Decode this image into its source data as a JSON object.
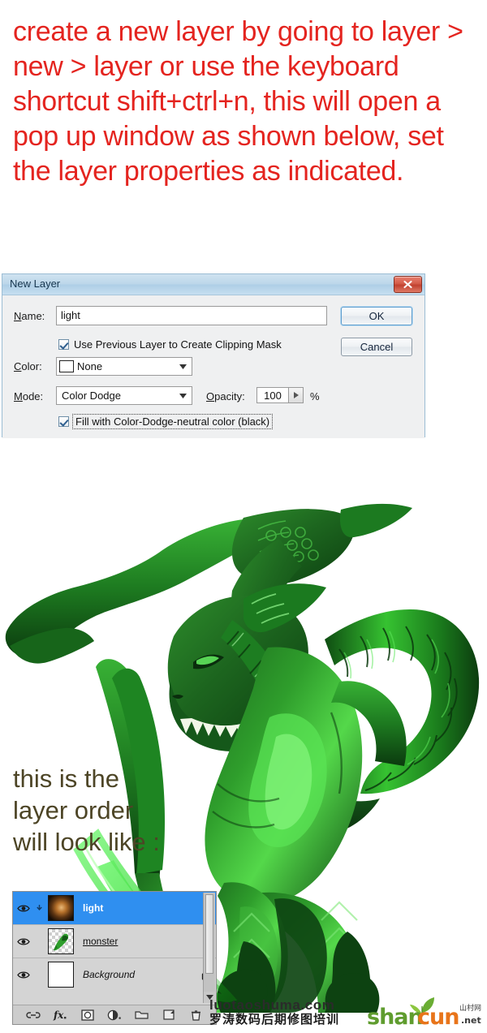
{
  "instruction": {
    "text": "create a new layer by going to layer > new > layer or use the keyboard shortcut shift+ctrl+n, this will open a pop up window as shown below, set the layer properties as indicated.",
    "color": "#e4241f"
  },
  "dialog": {
    "title": "New Layer",
    "close_icon": "close-icon",
    "name_label": "Name:",
    "name_label_mnemonic": "N",
    "name_value": "light",
    "clipping_mask_checkbox": {
      "label": "Use Previous Layer to Create Clipping Mask",
      "checked": true
    },
    "color_label": "Color:",
    "color_label_mnemonic": "C",
    "color_value": "None",
    "mode_label": "Mode:",
    "mode_label_mnemonic": "M",
    "mode_value": "Color Dodge",
    "opacity_label": "Opacity:",
    "opacity_label_mnemonic": "O",
    "opacity_value": "100",
    "opacity_unit": "%",
    "fill_neutral_checkbox": {
      "label": "Fill with Color-Dodge-neutral color (black)",
      "checked": true
    },
    "ok_button": "OK",
    "cancel_button": "Cancel",
    "titlebar_color": "#bcd7ea",
    "close_button_color": "#c0412f"
  },
  "artwork": {
    "description": "green-reptilian-monster-illustration",
    "body_color": "#1d6b1e",
    "highlight_color": "#3fd13f",
    "shadow_color": "#0b3d10",
    "glow_color": "#45e24a"
  },
  "caption": {
    "text": "this is the\nlayer order\nwill look like :",
    "color": "#4d4526"
  },
  "layers_panel": {
    "selected_row_color": "#2f8ff0",
    "layers": [
      {
        "name": "light",
        "visible": true,
        "selected": true,
        "clipped": true,
        "locked": false,
        "thumb": "light-glow-thumbnail",
        "eye_icon": "eye-icon",
        "clip_icon": "clipping-mask-icon"
      },
      {
        "name": "monster",
        "visible": true,
        "selected": false,
        "clipped": false,
        "locked": false,
        "thumb": "monster-transparent-thumbnail",
        "eye_icon": "eye-icon"
      },
      {
        "name": "Background",
        "visible": true,
        "selected": false,
        "clipped": false,
        "locked": true,
        "thumb": "white-background-thumbnail",
        "eye_icon": "eye-icon",
        "lock_icon": "lock-icon"
      }
    ],
    "toolbar_icons": [
      "link-layers-icon",
      "layer-styles-fx-icon",
      "add-layer-mask-icon",
      "new-adjustment-layer-icon",
      "new-group-icon",
      "new-layer-icon",
      "delete-layer-icon"
    ],
    "scroll_down_icon": "chevron-down-icon"
  },
  "watermarks": {
    "luotao": {
      "domain": "luotaoshuma.com",
      "chinese": "罗涛数码后期修图培训"
    },
    "shancun": {
      "part1": "shan",
      "part2": "cun",
      "chinese": "山村网",
      "tld": ".net",
      "part1_color": "#5f9c2e",
      "part2_color": "#e8741a"
    }
  }
}
